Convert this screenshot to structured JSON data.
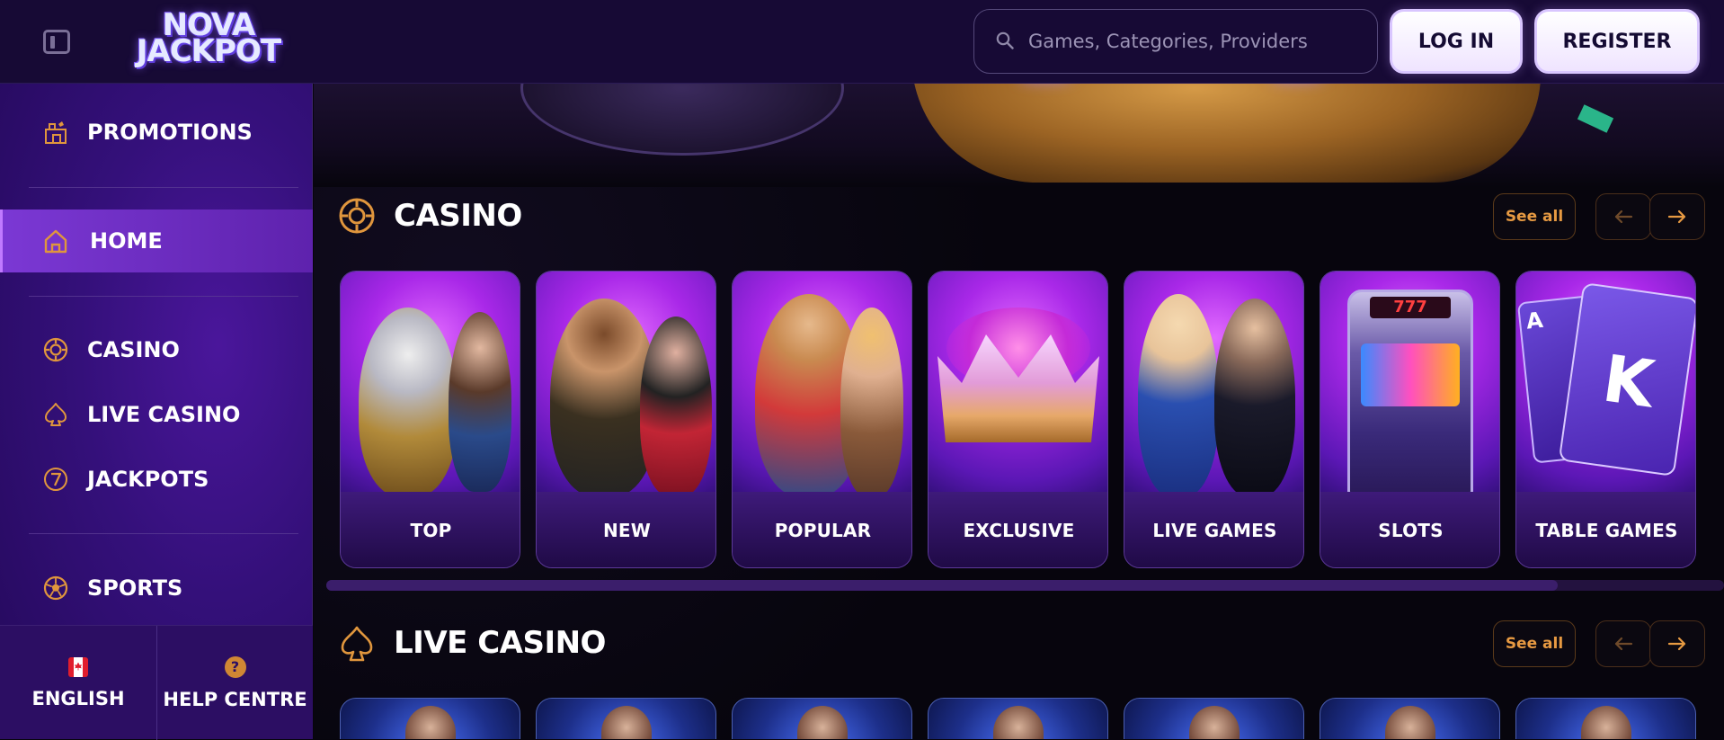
{
  "header": {
    "logo_line1": "NOVA",
    "logo_line2": "JACKPOT",
    "search_placeholder": "Games, Categories, Providers",
    "login_label": "LOG IN",
    "register_label": "REGISTER"
  },
  "sidebar": {
    "items": [
      {
        "label": "PROMOTIONS",
        "icon": "gift-shop-icon",
        "active": false
      },
      {
        "label": "HOME",
        "icon": "home-icon",
        "active": true
      },
      {
        "label": "CASINO",
        "icon": "casino-chip-icon",
        "active": false
      },
      {
        "label": "LIVE CASINO",
        "icon": "spade-icon",
        "active": false
      },
      {
        "label": "JACKPOTS",
        "icon": "seven-icon",
        "active": false
      },
      {
        "label": "SPORTS",
        "icon": "soccer-ball-icon",
        "active": false
      }
    ],
    "footer": {
      "language_label": "ENGLISH",
      "help_label": "HELP CENTRE",
      "help_glyph": "?"
    }
  },
  "sections": {
    "casino": {
      "title": "CASINO",
      "see_all": "See all",
      "tiles": [
        "TOP",
        "NEW",
        "POPULAR",
        "EXCLUSIVE",
        "LIVE GAMES",
        "SLOTS",
        "TABLE GAMES"
      ]
    },
    "live_casino": {
      "title": "LIVE CASINO",
      "see_all": "See all"
    }
  },
  "colors": {
    "accent_orange": "#e79a42",
    "header_bg": "#170a35",
    "sidebar_bg": "#34107a",
    "active_item": "#7b38d4",
    "main_bg": "#07050d"
  }
}
